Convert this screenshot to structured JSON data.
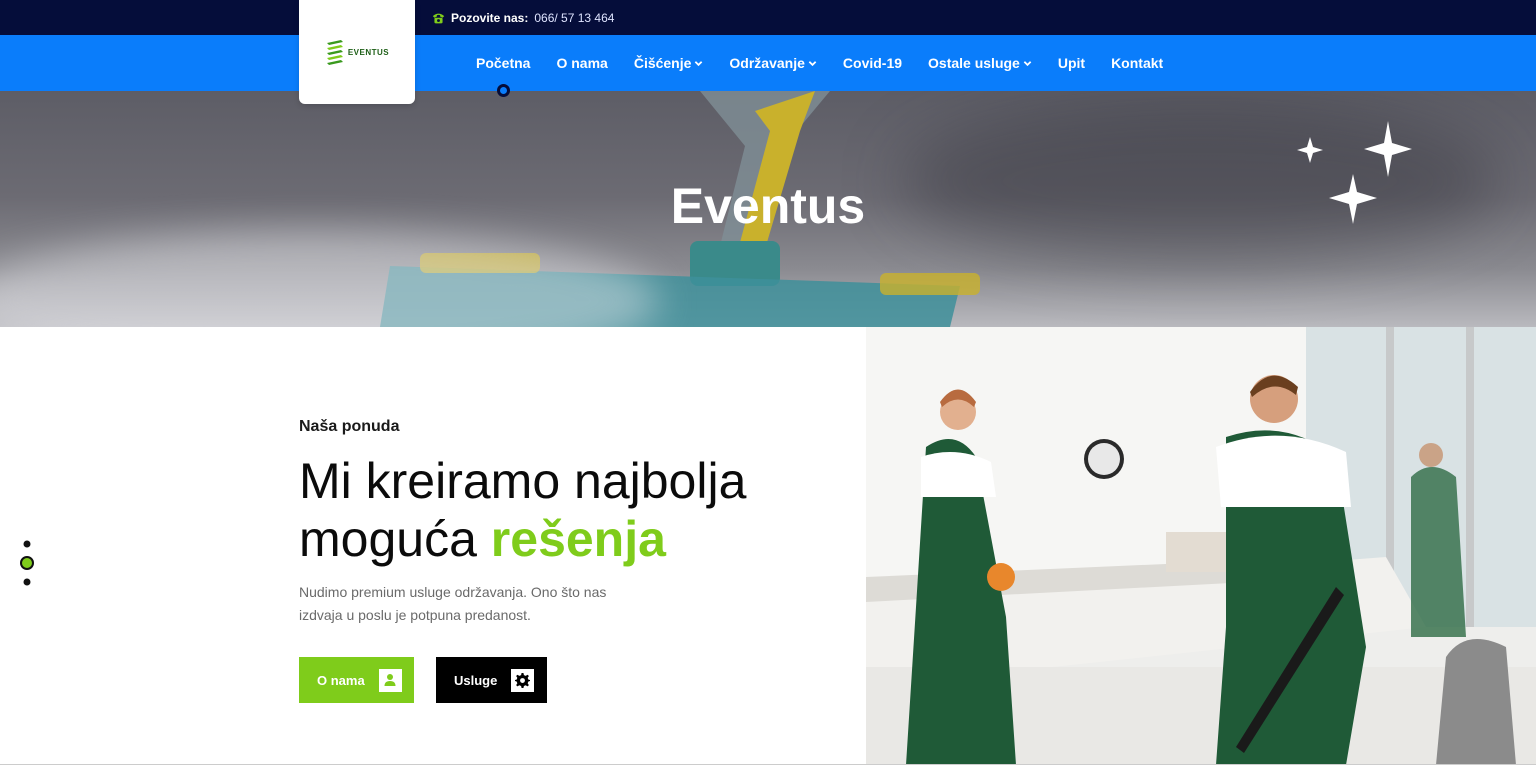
{
  "topbar": {
    "phone_label": "Pozovite nas:",
    "phone_number": "066/ 57 13 464",
    "phone_icon": "phone-icon"
  },
  "logo": {
    "text": "EVENTUS",
    "brand_green": "#7fcc1b"
  },
  "nav": {
    "items": [
      {
        "label": "Početna",
        "has_dropdown": false,
        "active": true
      },
      {
        "label": "O nama",
        "has_dropdown": false
      },
      {
        "label": "Čišćenje",
        "has_dropdown": true
      },
      {
        "label": "Održavanje",
        "has_dropdown": true
      },
      {
        "label": "Covid-19",
        "has_dropdown": false
      },
      {
        "label": "Ostale usluge",
        "has_dropdown": true
      },
      {
        "label": "Upit",
        "has_dropdown": false
      },
      {
        "label": "Kontakt",
        "has_dropdown": false
      }
    ],
    "bar_color": "#0a7dfb",
    "topbar_color": "#050d3a"
  },
  "hero": {
    "title": "Eventus"
  },
  "intro": {
    "kicker": "Naša ponuda",
    "headline_plain": "Mi kreiramo najbolja moguća",
    "headline_highlight": "rešenja",
    "description": "Nudimo premium usluge održavanja. Ono što nas izdvaja u poslu je potpuna predanost.",
    "accent_color": "#7fcc1b"
  },
  "buttons": {
    "primary_label": "O nama",
    "primary_icon": "user-icon",
    "secondary_label": "Usluge",
    "secondary_icon": "gear-icon"
  },
  "slider": {
    "dot_count": 3,
    "active_index": 1
  }
}
